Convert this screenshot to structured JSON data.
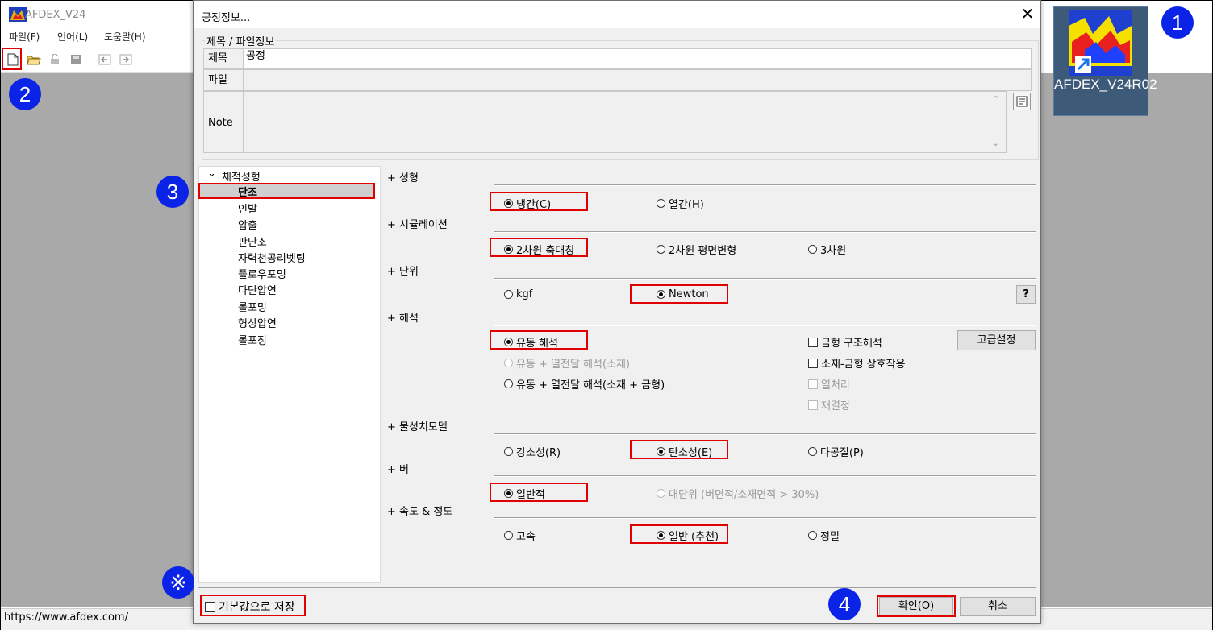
{
  "app": {
    "title": "AFDEX_V24",
    "menu": [
      "파일(F)",
      "언어(L)",
      "도움말(H)"
    ],
    "status_url": "https://www.afdex.com/"
  },
  "shortcut": {
    "label": "AFDEX_V24R02"
  },
  "dialog": {
    "title": "공정정보...",
    "group_title": "제목 / 파일정보",
    "fields": {
      "title_label": "제목",
      "title_value": "공정",
      "file_label": "파일",
      "file_value": "",
      "note_label": "Note",
      "note_value": ""
    },
    "tree": {
      "root": "체적성형",
      "items": [
        "단조",
        "인발",
        "압출",
        "판단조",
        "자력천공리벳팅",
        "플로우포밍",
        "다단압연",
        "롤포밍",
        "형상압연",
        "롤포징"
      ],
      "selected": "단조"
    },
    "sections": {
      "forming": {
        "label": "+ 성형",
        "options": [
          "냉간(C)",
          "열간(H)"
        ],
        "selected": "냉간(C)"
      },
      "simulation": {
        "label": "+ 시뮬레이션",
        "options": [
          "2차원 축대칭",
          "2차원 평면변형",
          "3차원"
        ],
        "selected": "2차원 축대칭"
      },
      "unit": {
        "label": "+ 단위",
        "options": [
          "kgf",
          "Newton"
        ],
        "selected": "Newton",
        "help": "?"
      },
      "analysis": {
        "label": "+ 해석",
        "options": [
          "유동 해석",
          "유동 + 열전달 해석(소재)",
          "유동 + 열전달 해석(소재 + 금형)"
        ],
        "selected": "유동 해석",
        "checks": [
          "금형 구조해석",
          "소재-금형 상호작용",
          "열처리",
          "재결정"
        ],
        "advanced_button": "고급설정"
      },
      "material_model": {
        "label": "+ 물성치모델",
        "options": [
          "강소성(R)",
          "탄소성(E)",
          "다공질(P)"
        ],
        "selected": "탄소성(E)"
      },
      "burr": {
        "label": "+ 버",
        "options": [
          "일반적",
          "대단위 (버면적/소재면적 > 30%)"
        ],
        "selected": "일반적"
      },
      "speed": {
        "label": "+ 속도 & 정도",
        "options": [
          "고속",
          "일반 (추천)",
          "정밀"
        ],
        "selected": "일반 (추천)"
      }
    },
    "save_default": "기본값으로 저장",
    "ok_button": "확인(O)",
    "cancel_button": "취소"
  },
  "badges": [
    "1",
    "2",
    "3",
    "4",
    "※"
  ],
  "colors": {
    "badge": "#0a23e6",
    "highlight": "#e00000",
    "workspace": "#a9a9a9"
  }
}
